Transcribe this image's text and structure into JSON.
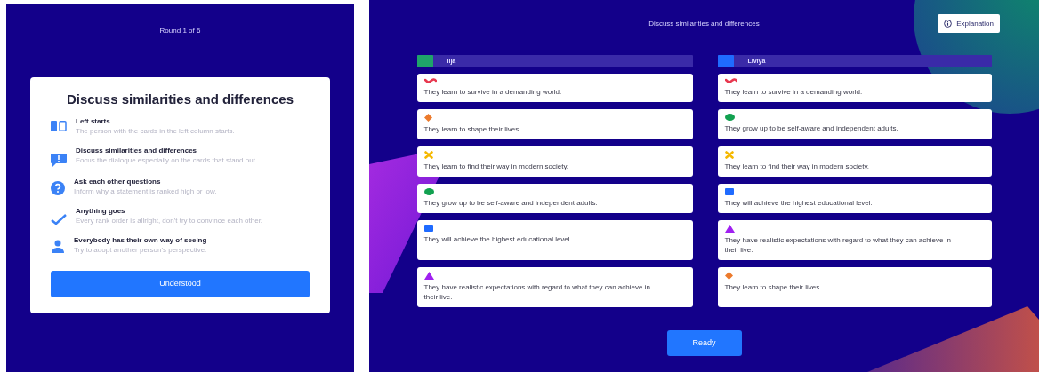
{
  "intro_screen": {
    "round_label": "Round 1 of 6",
    "dialog": {
      "title": "Discuss similarities and differences",
      "tips": [
        {
          "kind": "columns",
          "title": "Left starts",
          "text": "The person with the cards in the left column starts."
        },
        {
          "kind": "speech",
          "title": "Discuss similarities and differences",
          "text": "Focus the dialoque especially on the cards that stand out."
        },
        {
          "kind": "question",
          "title": "Ask each other questions",
          "text": "Inform why a statement is ranked high or low."
        },
        {
          "kind": "check",
          "title": "Anything goes",
          "text": "Every rank order is allright, don't try to convince each other."
        },
        {
          "kind": "person",
          "title": "Everybody has their own way of seeing",
          "text": "Try to adopt another person's perspective."
        }
      ],
      "button": "Understood"
    }
  },
  "compare_screen": {
    "title": "Discuss similarities and differences",
    "explanation_button": "Explanation",
    "columns": [
      {
        "name": "Ilja",
        "color": "#1fa36a",
        "cards": [
          {
            "kind": "wave",
            "color": "#e8384f",
            "text": "They learn to survive in a demanding world."
          },
          {
            "kind": "diamond",
            "color": "#ec7a2c",
            "text": "They learn to shape their lives."
          },
          {
            "kind": "cross",
            "color": "#f5b800",
            "text": "They learn to find their way in modern society."
          },
          {
            "kind": "circle",
            "color": "#12a150",
            "text": "They grow up to be self-aware and independent adults."
          },
          {
            "kind": "square",
            "color": "#1f6bff",
            "text": "They will achieve the highest educational level."
          },
          {
            "kind": "triangle",
            "color": "#a020f0",
            "text": "They have realistic expectations with regard to what they can achieve in their live."
          }
        ]
      },
      {
        "name": "Liviya",
        "color": "#1f6bff",
        "cards": [
          {
            "kind": "wave",
            "color": "#e8384f",
            "text": "They learn to survive in a demanding world."
          },
          {
            "kind": "circle",
            "color": "#12a150",
            "text": "They grow up to be self-aware and independent adults."
          },
          {
            "kind": "cross",
            "color": "#f5b800",
            "text": "They learn to find their way in modern society."
          },
          {
            "kind": "square",
            "color": "#1f6bff",
            "text": "They will achieve the highest educational level."
          },
          {
            "kind": "triangle",
            "color": "#a020f0",
            "text": "They have realistic expectations with regard to what they can achieve in their live."
          },
          {
            "kind": "diamond",
            "color": "#ec7a2c",
            "text": "They learn to shape their lives."
          }
        ]
      }
    ],
    "ready_button": "Ready"
  }
}
